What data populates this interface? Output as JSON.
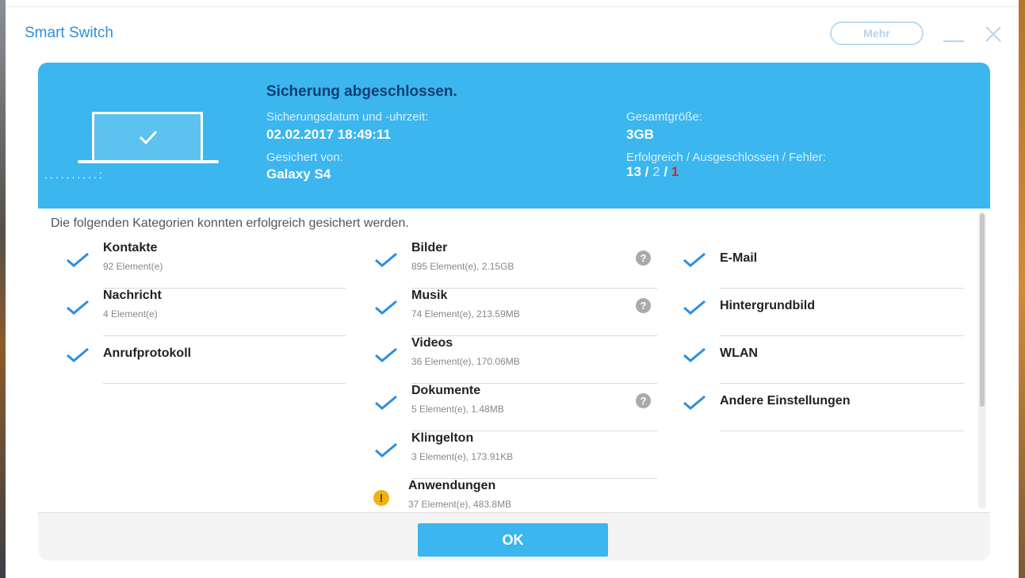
{
  "window": {
    "title": "Smart Switch",
    "more_label": "Mehr"
  },
  "header": {
    "status": "Sicherung abgeschlossen.",
    "date_label": "Sicherungsdatum und -uhrzeit:",
    "date_value": "02.02.2017 18:49:11",
    "device_label": "Gesichert von:",
    "device_value": "Galaxy S4",
    "size_label": "Gesamtgröße:",
    "size_value": "3GB",
    "counts_label": "Erfolgreich / Ausgeschlossen / Fehler:",
    "success_count": "13",
    "excluded_count": "2",
    "error_count": "1",
    "progress_dots": "..........:"
  },
  "content": {
    "intro": "Die folgenden Kategorien konnten erfolgreich gesichert werden.",
    "col1": [
      {
        "name": "Kontakte",
        "detail": "92 Element(e)"
      },
      {
        "name": "Nachricht",
        "detail": "4 Element(e)"
      },
      {
        "name": "Anrufprotokoll",
        "detail": ""
      }
    ],
    "col2": [
      {
        "name": "Bilder",
        "detail": "895 Element(e), 2.15GB"
      },
      {
        "name": "Musik",
        "detail": "74 Element(e), 213.59MB"
      },
      {
        "name": "Videos",
        "detail": "36 Element(e), 170.06MB"
      },
      {
        "name": "Dokumente",
        "detail": "5 Element(e), 1.48MB"
      },
      {
        "name": "Klingelton",
        "detail": "3 Element(e), 173.91KB"
      },
      {
        "name": "Anwendungen",
        "detail": "37 Element(e), 483.8MB"
      }
    ],
    "col3": [
      {
        "name": "E-Mail"
      },
      {
        "name": "Hintergrundbild"
      },
      {
        "name": "WLAN"
      },
      {
        "name": "Andere Einstellungen"
      }
    ]
  },
  "footer": {
    "ok_label": "OK"
  },
  "colors": {
    "accent": "#3bb6ef",
    "status_text": "#0e3f75",
    "check": "#2c8fe0",
    "error": "#d7262b",
    "warning": "#f2b10f"
  },
  "icons": {
    "check": "check-icon",
    "help": "help-icon",
    "warning": "warning-icon",
    "laptop": "laptop-icon"
  }
}
